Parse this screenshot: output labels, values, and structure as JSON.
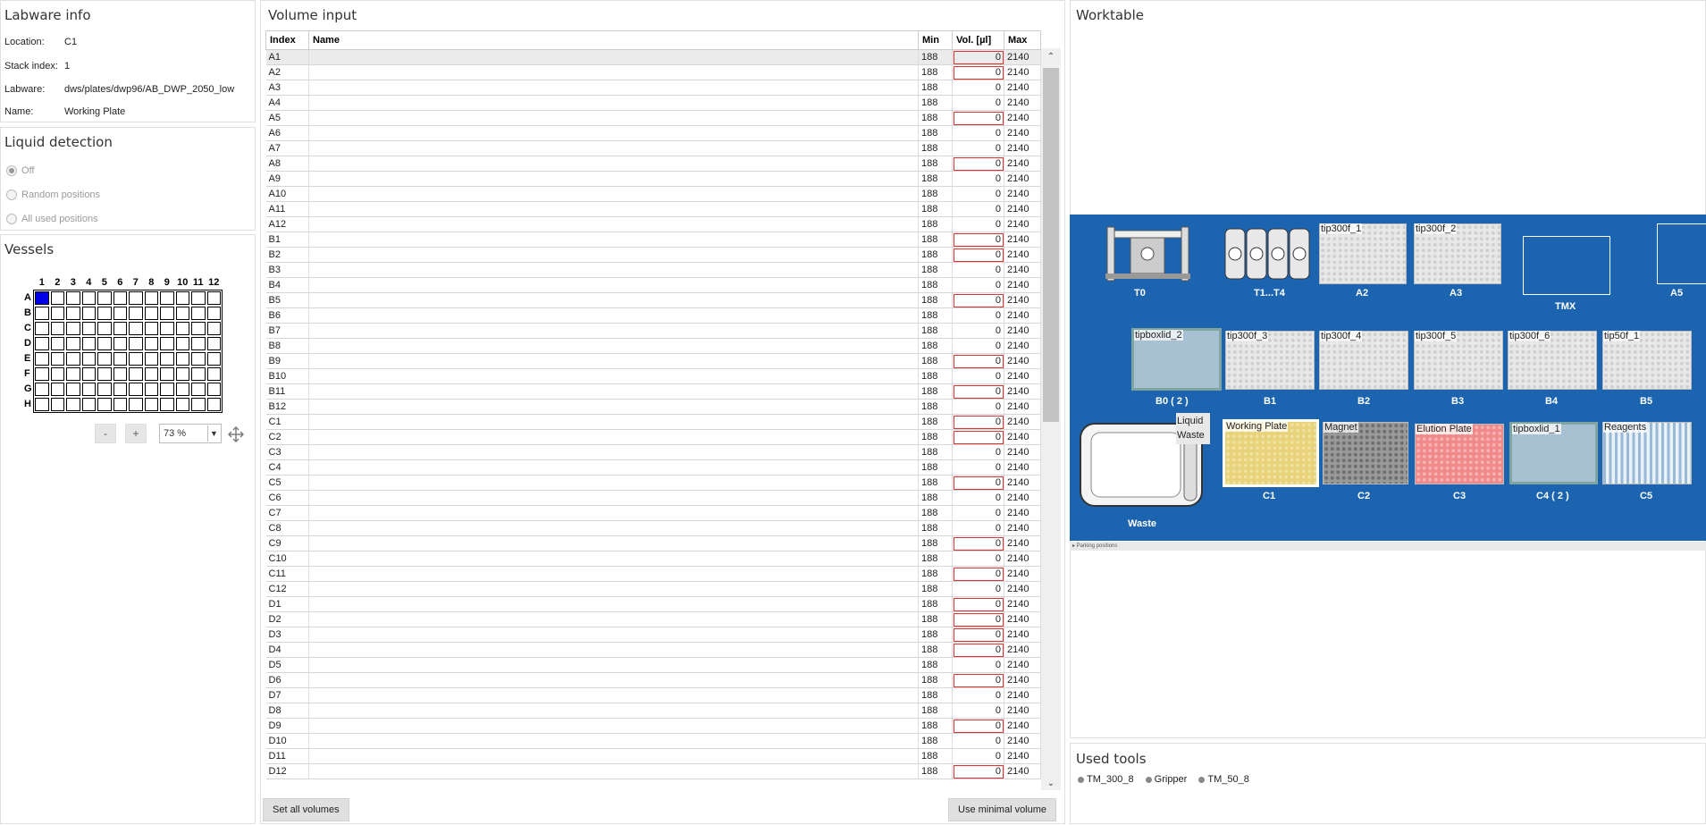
{
  "labware_info": {
    "title": "Labware info",
    "fields": [
      {
        "label": "Location:",
        "value": "C1"
      },
      {
        "label": "Stack index:",
        "value": "1"
      },
      {
        "label": "Labware:",
        "value": "dws/plates/dwp96/AB_DWP_2050_low"
      },
      {
        "label": "Name:",
        "value": "Working Plate"
      }
    ]
  },
  "liquid_detection": {
    "title": "Liquid detection",
    "options": [
      "Off",
      "Random positions",
      "All used positions"
    ],
    "selected": "Off"
  },
  "vessels": {
    "title": "Vessels",
    "columns": [
      "1",
      "2",
      "3",
      "4",
      "5",
      "6",
      "7",
      "8",
      "9",
      "10",
      "11",
      "12"
    ],
    "rows": [
      "A",
      "B",
      "C",
      "D",
      "E",
      "F",
      "G",
      "H"
    ],
    "selected_cell": "A1",
    "minus": "-",
    "plus": "+",
    "zoom": "73 %"
  },
  "volume_input": {
    "title": "Volume input",
    "headers": [
      "Index",
      "Name",
      "Min",
      "Vol. [µl]",
      "Max"
    ],
    "rows": [
      {
        "index": "A1",
        "name": "",
        "min": "188",
        "vol": "0",
        "max": "2140",
        "flag": true
      },
      {
        "index": "A2",
        "name": "",
        "min": "188",
        "vol": "0",
        "max": "2140",
        "flag": true
      },
      {
        "index": "A3",
        "name": "",
        "min": "188",
        "vol": "0",
        "max": "2140",
        "flag": false
      },
      {
        "index": "A4",
        "name": "",
        "min": "188",
        "vol": "0",
        "max": "2140",
        "flag": false
      },
      {
        "index": "A5",
        "name": "",
        "min": "188",
        "vol": "0",
        "max": "2140",
        "flag": true
      },
      {
        "index": "A6",
        "name": "",
        "min": "188",
        "vol": "0",
        "max": "2140",
        "flag": false
      },
      {
        "index": "A7",
        "name": "",
        "min": "188",
        "vol": "0",
        "max": "2140",
        "flag": false
      },
      {
        "index": "A8",
        "name": "",
        "min": "188",
        "vol": "0",
        "max": "2140",
        "flag": true
      },
      {
        "index": "A9",
        "name": "",
        "min": "188",
        "vol": "0",
        "max": "2140",
        "flag": false
      },
      {
        "index": "A10",
        "name": "",
        "min": "188",
        "vol": "0",
        "max": "2140",
        "flag": false
      },
      {
        "index": "A11",
        "name": "",
        "min": "188",
        "vol": "0",
        "max": "2140",
        "flag": false
      },
      {
        "index": "A12",
        "name": "",
        "min": "188",
        "vol": "0",
        "max": "2140",
        "flag": false
      },
      {
        "index": "B1",
        "name": "",
        "min": "188",
        "vol": "0",
        "max": "2140",
        "flag": true
      },
      {
        "index": "B2",
        "name": "",
        "min": "188",
        "vol": "0",
        "max": "2140",
        "flag": true
      },
      {
        "index": "B3",
        "name": "",
        "min": "188",
        "vol": "0",
        "max": "2140",
        "flag": false
      },
      {
        "index": "B4",
        "name": "",
        "min": "188",
        "vol": "0",
        "max": "2140",
        "flag": false
      },
      {
        "index": "B5",
        "name": "",
        "min": "188",
        "vol": "0",
        "max": "2140",
        "flag": true
      },
      {
        "index": "B6",
        "name": "",
        "min": "188",
        "vol": "0",
        "max": "2140",
        "flag": false
      },
      {
        "index": "B7",
        "name": "",
        "min": "188",
        "vol": "0",
        "max": "2140",
        "flag": false
      },
      {
        "index": "B8",
        "name": "",
        "min": "188",
        "vol": "0",
        "max": "2140",
        "flag": false
      },
      {
        "index": "B9",
        "name": "",
        "min": "188",
        "vol": "0",
        "max": "2140",
        "flag": true
      },
      {
        "index": "B10",
        "name": "",
        "min": "188",
        "vol": "0",
        "max": "2140",
        "flag": false
      },
      {
        "index": "B11",
        "name": "",
        "min": "188",
        "vol": "0",
        "max": "2140",
        "flag": true
      },
      {
        "index": "B12",
        "name": "",
        "min": "188",
        "vol": "0",
        "max": "2140",
        "flag": false
      },
      {
        "index": "C1",
        "name": "",
        "min": "188",
        "vol": "0",
        "max": "2140",
        "flag": true
      },
      {
        "index": "C2",
        "name": "",
        "min": "188",
        "vol": "0",
        "max": "2140",
        "flag": true
      },
      {
        "index": "C3",
        "name": "",
        "min": "188",
        "vol": "0",
        "max": "2140",
        "flag": false
      },
      {
        "index": "C4",
        "name": "",
        "min": "188",
        "vol": "0",
        "max": "2140",
        "flag": false
      },
      {
        "index": "C5",
        "name": "",
        "min": "188",
        "vol": "0",
        "max": "2140",
        "flag": true
      },
      {
        "index": "C6",
        "name": "",
        "min": "188",
        "vol": "0",
        "max": "2140",
        "flag": false
      },
      {
        "index": "C7",
        "name": "",
        "min": "188",
        "vol": "0",
        "max": "2140",
        "flag": false
      },
      {
        "index": "C8",
        "name": "",
        "min": "188",
        "vol": "0",
        "max": "2140",
        "flag": false
      },
      {
        "index": "C9",
        "name": "",
        "min": "188",
        "vol": "0",
        "max": "2140",
        "flag": true
      },
      {
        "index": "C10",
        "name": "",
        "min": "188",
        "vol": "0",
        "max": "2140",
        "flag": false
      },
      {
        "index": "C11",
        "name": "",
        "min": "188",
        "vol": "0",
        "max": "2140",
        "flag": true
      },
      {
        "index": "C12",
        "name": "",
        "min": "188",
        "vol": "0",
        "max": "2140",
        "flag": false
      },
      {
        "index": "D1",
        "name": "",
        "min": "188",
        "vol": "0",
        "max": "2140",
        "flag": true
      },
      {
        "index": "D2",
        "name": "",
        "min": "188",
        "vol": "0",
        "max": "2140",
        "flag": true
      },
      {
        "index": "D3",
        "name": "",
        "min": "188",
        "vol": "0",
        "max": "2140",
        "flag": true
      },
      {
        "index": "D4",
        "name": "",
        "min": "188",
        "vol": "0",
        "max": "2140",
        "flag": true
      },
      {
        "index": "D5",
        "name": "",
        "min": "188",
        "vol": "0",
        "max": "2140",
        "flag": false
      },
      {
        "index": "D6",
        "name": "",
        "min": "188",
        "vol": "0",
        "max": "2140",
        "flag": true
      },
      {
        "index": "D7",
        "name": "",
        "min": "188",
        "vol": "0",
        "max": "2140",
        "flag": false
      },
      {
        "index": "D8",
        "name": "",
        "min": "188",
        "vol": "0",
        "max": "2140",
        "flag": false
      },
      {
        "index": "D9",
        "name": "",
        "min": "188",
        "vol": "0",
        "max": "2140",
        "flag": true
      },
      {
        "index": "D10",
        "name": "",
        "min": "188",
        "vol": "0",
        "max": "2140",
        "flag": false
      },
      {
        "index": "D11",
        "name": "",
        "min": "188",
        "vol": "0",
        "max": "2140",
        "flag": false
      },
      {
        "index": "D12",
        "name": "",
        "min": "188",
        "vol": "0",
        "max": "2140",
        "flag": true
      }
    ],
    "set_all_volumes": "Set all volumes",
    "use_minimal_volume": "Use minimal volume"
  },
  "worktable": {
    "title": "Worktable",
    "positions": {
      "T0": "T0",
      "T1T4": "T1...T4",
      "A2": "A2",
      "A3": "A3",
      "TMX": "TMX",
      "A5": "A5",
      "B0": "B0 ( 2 )",
      "B1": "B1",
      "B2": "B2",
      "B3": "B3",
      "B4": "B4",
      "B5": "B5",
      "Waste": "Waste",
      "C1": "C1",
      "C2": "C2",
      "C3": "C3",
      "C4": "C4 ( 2 )",
      "C5": "C5"
    },
    "labels": {
      "A2": "tip300f_1",
      "A3": "tip300f_2",
      "B0": "tipboxlid_2",
      "B1": "tip300f_3",
      "B2": "tip300f_4",
      "B3": "tip300f_5",
      "B4": "tip300f_6",
      "B5": "tip50f_1",
      "liquid_waste": "Liquid\nWaste",
      "C1": "Working Plate",
      "C2": "Magnet",
      "C3": "Elution Plate",
      "C4": "tipboxlid_1",
      "C5": "Reagents"
    },
    "parking": "▸ Parking positions",
    "colors": {
      "deck": "#1c64b0",
      "working_plate": "#e8d27a",
      "elution_plate": "#f08a8a"
    }
  },
  "used_tools": {
    "title": "Used tools",
    "tools": [
      "TM_300_8",
      "Gripper",
      "TM_50_8"
    ]
  }
}
